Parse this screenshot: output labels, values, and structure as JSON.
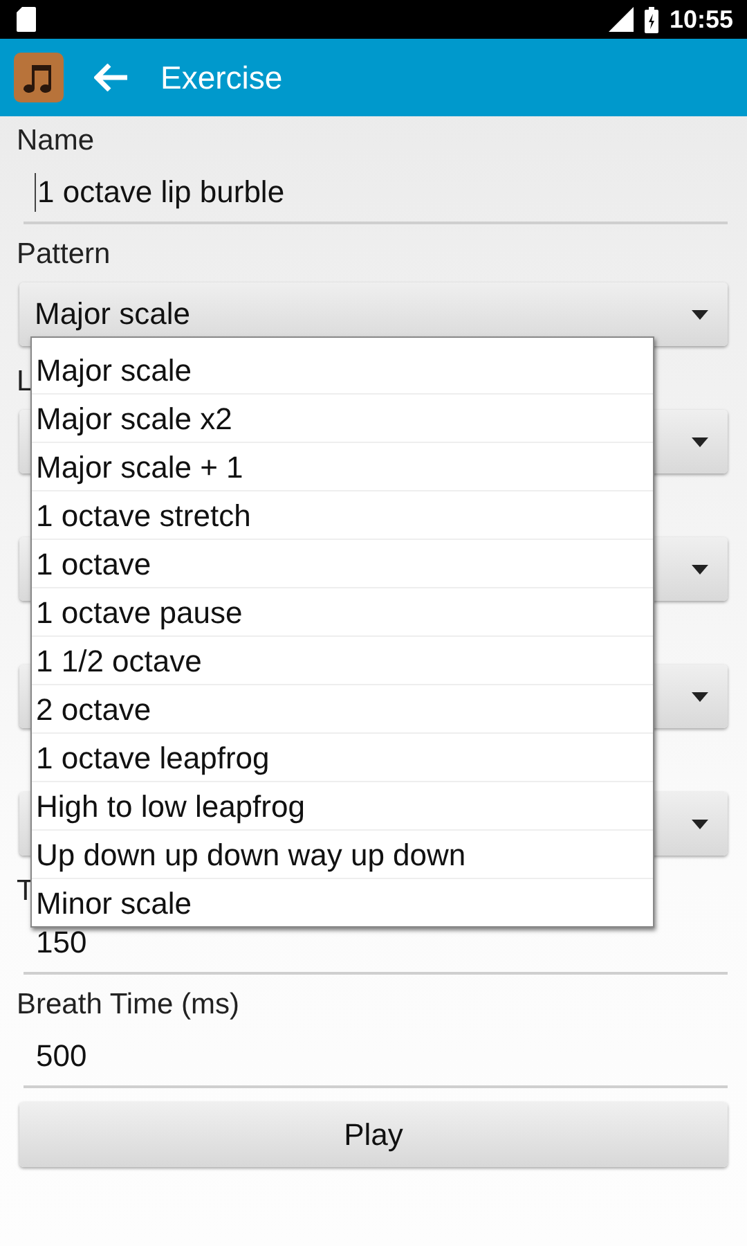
{
  "status_bar": {
    "time": "10:55"
  },
  "app_bar": {
    "title": "Exercise"
  },
  "form": [
    {
      "kind": "label",
      "text": "Name"
    },
    {
      "kind": "input",
      "value": "1 octave lip burble",
      "focused": true
    },
    {
      "kind": "label",
      "text": "Pattern"
    },
    {
      "kind": "spinner",
      "value": "Major scale"
    },
    {
      "kind": "label",
      "text": "L"
    },
    {
      "kind": "spinner"
    },
    {
      "kind": "spinner"
    },
    {
      "kind": "spinner"
    },
    {
      "kind": "spinner"
    },
    {
      "kind": "label",
      "text": "T"
    },
    {
      "kind": "input",
      "value": "150",
      "focused": false
    },
    {
      "kind": "label",
      "text": "Breath Time (ms)"
    },
    {
      "kind": "input",
      "value": "500",
      "focused": false
    },
    {
      "kind": "button",
      "text": "Play"
    }
  ],
  "dropdown": {
    "items": [
      "Major scale",
      "Major scale x2",
      "Major scale + 1",
      "1 octave stretch",
      "1 octave",
      "1 octave pause",
      "1 1/2 octave",
      "2 octave",
      "1 octave leapfrog",
      "High to low leapfrog",
      "Up down up down way up down",
      "Minor scale"
    ]
  }
}
